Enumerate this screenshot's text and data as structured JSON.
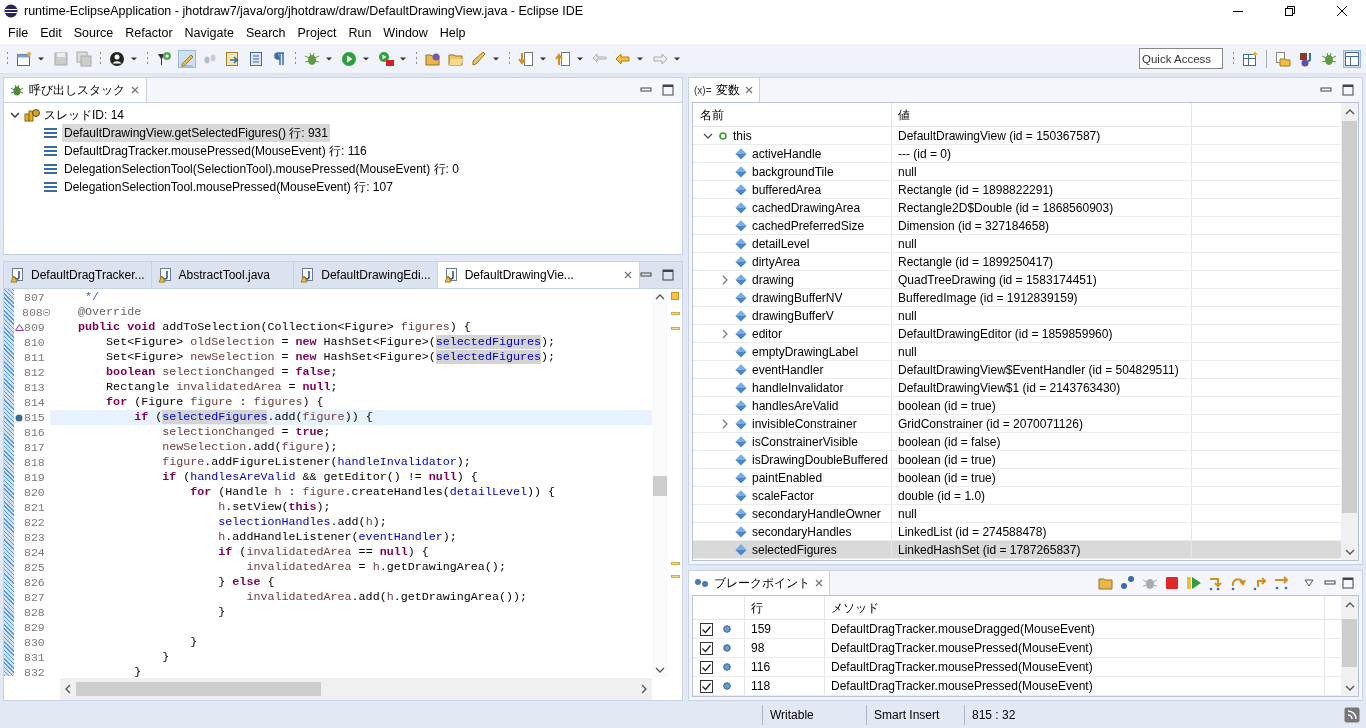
{
  "window": {
    "title": "runtime-EclipseApplication - jhotdraw7/java/org/jhotdraw/draw/DefaultDrawingView.java - Eclipse IDE"
  },
  "menu": [
    "File",
    "Edit",
    "Source",
    "Refactor",
    "Navigate",
    "Search",
    "Project",
    "Run",
    "Window",
    "Help"
  ],
  "quick_access": {
    "placeholder": "Quick Access"
  },
  "call_stack": {
    "title": "呼び出しスタック",
    "thread": {
      "label": "スレッドID: 14",
      "expanded": true
    },
    "frames": [
      {
        "label": "DefaultDrawingView.getSelectedFigures() 行: 931",
        "selected": true
      },
      {
        "label": "DefaultDragTracker.mousePressed(MouseEvent) 行: 116",
        "selected": false
      },
      {
        "label": "DelegationSelectionTool(SelectionTool).mousePressed(MouseEvent) 行: 0",
        "selected": false
      },
      {
        "label": "DelegationSelectionTool.mousePressed(MouseEvent) 行: 107",
        "selected": false
      }
    ]
  },
  "editor": {
    "tabs": [
      {
        "label": "DefaultDragTracker...",
        "selected": false
      },
      {
        "label": "AbstractTool.java",
        "selected": false
      },
      {
        "label": "DefaultDrawingEdi...",
        "selected": false
      },
      {
        "label": "DefaultDrawingVie...",
        "selected": true
      }
    ],
    "lines": [
      {
        "number": "807",
        "current": false,
        "breakpoint": false,
        "override": false,
        "fold_control": false,
        "tokens": [
          {
            "kind": "c",
            "text": "     */"
          }
        ]
      },
      {
        "number": "808",
        "current": false,
        "breakpoint": false,
        "override": false,
        "fold_control": true,
        "tokens": [
          {
            "kind": "a",
            "text": "    @Override"
          }
        ]
      },
      {
        "number": "809",
        "current": false,
        "breakpoint": false,
        "override": true,
        "fold_control": false,
        "tokens": [
          {
            "kind": "k",
            "text": "    public "
          },
          {
            "kind": "k",
            "text": "void"
          },
          {
            "kind": "t",
            "text": " addToSelection(Collection<Figure> "
          },
          {
            "kind": "v",
            "text": "figures"
          },
          {
            "kind": "t",
            "text": ") {"
          }
        ]
      },
      {
        "number": "810",
        "current": false,
        "breakpoint": false,
        "override": false,
        "fold_control": false,
        "tokens": [
          {
            "kind": "t",
            "text": "        Set<Figure> "
          },
          {
            "kind": "v",
            "text": "oldSelection"
          },
          {
            "kind": "t",
            "text": " = "
          },
          {
            "kind": "k",
            "text": "new"
          },
          {
            "kind": "t",
            "text": " HashSet<Figure>("
          },
          {
            "kind": "o",
            "text": "selectedFigures"
          },
          {
            "kind": "t",
            "text": ");"
          }
        ]
      },
      {
        "number": "811",
        "current": false,
        "breakpoint": false,
        "override": false,
        "fold_control": false,
        "tokens": [
          {
            "kind": "t",
            "text": "        Set<Figure> "
          },
          {
            "kind": "v",
            "text": "newSelection"
          },
          {
            "kind": "t",
            "text": " = "
          },
          {
            "kind": "k",
            "text": "new"
          },
          {
            "kind": "t",
            "text": " HashSet<Figure>("
          },
          {
            "kind": "o",
            "text": "selectedFigures"
          },
          {
            "kind": "t",
            "text": ");"
          }
        ]
      },
      {
        "number": "812",
        "current": false,
        "breakpoint": false,
        "override": false,
        "fold_control": false,
        "tokens": [
          {
            "kind": "k",
            "text": "        boolean"
          },
          {
            "kind": "v",
            "text": " selectionChanged"
          },
          {
            "kind": "t",
            "text": " = "
          },
          {
            "kind": "k",
            "text": "false"
          },
          {
            "kind": "t",
            "text": ";"
          }
        ]
      },
      {
        "number": "813",
        "current": false,
        "breakpoint": false,
        "override": false,
        "fold_control": false,
        "tokens": [
          {
            "kind": "t",
            "text": "        Rectangle "
          },
          {
            "kind": "v",
            "text": "invalidatedArea"
          },
          {
            "kind": "t",
            "text": " = "
          },
          {
            "kind": "k",
            "text": "null"
          },
          {
            "kind": "t",
            "text": ";"
          }
        ]
      },
      {
        "number": "814",
        "current": false,
        "breakpoint": false,
        "override": false,
        "fold_control": false,
        "tokens": [
          {
            "kind": "k",
            "text": "        for"
          },
          {
            "kind": "t",
            "text": " (Figure "
          },
          {
            "kind": "v",
            "text": "figure"
          },
          {
            "kind": "t",
            "text": " : "
          },
          {
            "kind": "v",
            "text": "figures"
          },
          {
            "kind": "t",
            "text": ") {"
          }
        ]
      },
      {
        "number": "815",
        "current": true,
        "breakpoint": true,
        "override": false,
        "fold_control": false,
        "tokens": [
          {
            "kind": "k",
            "text": "            if"
          },
          {
            "kind": "t",
            "text": " ("
          },
          {
            "kind": "o",
            "text": "selectedFigures"
          },
          {
            "kind": "t",
            "text": ".add("
          },
          {
            "kind": "v",
            "text": "figure"
          },
          {
            "kind": "t",
            "text": ")) {"
          }
        ]
      },
      {
        "number": "816",
        "current": false,
        "breakpoint": false,
        "override": false,
        "fold_control": false,
        "tokens": [
          {
            "kind": "v",
            "text": "                selectionChanged"
          },
          {
            "kind": "t",
            "text": " = "
          },
          {
            "kind": "k",
            "text": "true"
          },
          {
            "kind": "t",
            "text": ";"
          }
        ]
      },
      {
        "number": "817",
        "current": false,
        "breakpoint": false,
        "override": false,
        "fold_control": false,
        "tokens": [
          {
            "kind": "v",
            "text": "                newSelection"
          },
          {
            "kind": "t",
            "text": ".add("
          },
          {
            "kind": "v",
            "text": "figure"
          },
          {
            "kind": "t",
            "text": ");"
          }
        ]
      },
      {
        "number": "818",
        "current": false,
        "breakpoint": false,
        "override": false,
        "fold_control": false,
        "tokens": [
          {
            "kind": "v",
            "text": "                figure"
          },
          {
            "kind": "t",
            "text": ".addFigureListener("
          },
          {
            "kind": "f",
            "text": "handleInvalidator"
          },
          {
            "kind": "t",
            "text": ");"
          }
        ]
      },
      {
        "number": "819",
        "current": false,
        "breakpoint": false,
        "override": false,
        "fold_control": false,
        "tokens": [
          {
            "kind": "k",
            "text": "                if"
          },
          {
            "kind": "t",
            "text": " ("
          },
          {
            "kind": "f",
            "text": "handlesAreValid"
          },
          {
            "kind": "t",
            "text": " && getEditor() != "
          },
          {
            "kind": "k",
            "text": "null"
          },
          {
            "kind": "t",
            "text": ") {"
          }
        ]
      },
      {
        "number": "820",
        "current": false,
        "breakpoint": false,
        "override": false,
        "fold_control": false,
        "tokens": [
          {
            "kind": "k",
            "text": "                    for"
          },
          {
            "kind": "t",
            "text": " (Handle "
          },
          {
            "kind": "v",
            "text": "h"
          },
          {
            "kind": "t",
            "text": " : "
          },
          {
            "kind": "v",
            "text": "figure"
          },
          {
            "kind": "t",
            "text": ".createHandles("
          },
          {
            "kind": "f",
            "text": "detailLevel"
          },
          {
            "kind": "t",
            "text": ")) {"
          }
        ]
      },
      {
        "number": "821",
        "current": false,
        "breakpoint": false,
        "override": false,
        "fold_control": false,
        "tokens": [
          {
            "kind": "v",
            "text": "                        h"
          },
          {
            "kind": "t",
            "text": ".setView("
          },
          {
            "kind": "k",
            "text": "this"
          },
          {
            "kind": "t",
            "text": ");"
          }
        ]
      },
      {
        "number": "822",
        "current": false,
        "breakpoint": false,
        "override": false,
        "fold_control": false,
        "tokens": [
          {
            "kind": "f",
            "text": "                        selectionHandles"
          },
          {
            "kind": "t",
            "text": ".add("
          },
          {
            "kind": "v",
            "text": "h"
          },
          {
            "kind": "t",
            "text": ");"
          }
        ]
      },
      {
        "number": "823",
        "current": false,
        "breakpoint": false,
        "override": false,
        "fold_control": false,
        "tokens": [
          {
            "kind": "v",
            "text": "                        h"
          },
          {
            "kind": "t",
            "text": ".addHandleListener("
          },
          {
            "kind": "f",
            "text": "eventHandler"
          },
          {
            "kind": "t",
            "text": ");"
          }
        ]
      },
      {
        "number": "824",
        "current": false,
        "breakpoint": false,
        "override": false,
        "fold_control": false,
        "tokens": [
          {
            "kind": "k",
            "text": "                        if"
          },
          {
            "kind": "t",
            "text": " ("
          },
          {
            "kind": "v",
            "text": "invalidatedArea"
          },
          {
            "kind": "t",
            "text": " == "
          },
          {
            "kind": "k",
            "text": "null"
          },
          {
            "kind": "t",
            "text": ") {"
          }
        ]
      },
      {
        "number": "825",
        "current": false,
        "breakpoint": false,
        "override": false,
        "fold_control": false,
        "tokens": [
          {
            "kind": "v",
            "text": "                            invalidatedArea"
          },
          {
            "kind": "t",
            "text": " = "
          },
          {
            "kind": "v",
            "text": "h"
          },
          {
            "kind": "t",
            "text": ".getDrawingArea();"
          }
        ]
      },
      {
        "number": "826",
        "current": false,
        "breakpoint": false,
        "override": false,
        "fold_control": false,
        "tokens": [
          {
            "kind": "t",
            "text": "                        } "
          },
          {
            "kind": "k",
            "text": "else"
          },
          {
            "kind": "t",
            "text": " {"
          }
        ]
      },
      {
        "number": "827",
        "current": false,
        "breakpoint": false,
        "override": false,
        "fold_control": false,
        "tokens": [
          {
            "kind": "v",
            "text": "                            invalidatedArea"
          },
          {
            "kind": "t",
            "text": ".add("
          },
          {
            "kind": "v",
            "text": "h"
          },
          {
            "kind": "t",
            "text": ".getDrawingArea());"
          }
        ]
      },
      {
        "number": "828",
        "current": false,
        "breakpoint": false,
        "override": false,
        "fold_control": false,
        "tokens": [
          {
            "kind": "t",
            "text": "                        }"
          }
        ]
      },
      {
        "number": "829",
        "current": false,
        "breakpoint": false,
        "override": false,
        "fold_control": false
      },
      {
        "number": "830",
        "current": false,
        "breakpoint": false,
        "override": false,
        "fold_control": false,
        "tokens": [
          {
            "kind": "t",
            "text": "                    }"
          }
        ]
      },
      {
        "number": "831",
        "current": false,
        "breakpoint": false,
        "override": false,
        "fold_control": false,
        "tokens": [
          {
            "kind": "t",
            "text": "                }"
          }
        ]
      },
      {
        "number": "832",
        "current": false,
        "breakpoint": false,
        "override": false,
        "fold_control": false,
        "tokens": [
          {
            "kind": "t",
            "text": "            }"
          }
        ]
      }
    ]
  },
  "variables": {
    "title": "変数",
    "title_prefix": "(x)=",
    "columns": [
      "名前",
      "値"
    ],
    "rows": [
      {
        "name": "this",
        "value": "DefaultDrawingView (id = 150367587)",
        "expanded": true,
        "selected": false,
        "children": [
          {
            "name": "activeHandle",
            "value": "--- (id = 0)",
            "expandable": false,
            "selected": false
          },
          {
            "name": "backgroundTile",
            "value": "null",
            "expandable": false,
            "selected": false
          },
          {
            "name": "bufferedArea",
            "value": "Rectangle (id = 1898822291)",
            "expandable": false,
            "selected": false
          },
          {
            "name": "cachedDrawingArea",
            "value": "Rectangle2D$Double (id = 1868560903)",
            "expandable": false,
            "selected": false
          },
          {
            "name": "cachedPreferredSize",
            "value": "Dimension (id = 327184658)",
            "expandable": false,
            "selected": false
          },
          {
            "name": "detailLevel",
            "value": "null",
            "expandable": false,
            "selected": false
          },
          {
            "name": "dirtyArea",
            "value": "Rectangle (id = 1899250417)",
            "expandable": false,
            "selected": false
          },
          {
            "name": "drawing",
            "value": "QuadTreeDrawing (id = 1583174451)",
            "expandable": true,
            "selected": false
          },
          {
            "name": "drawingBufferNV",
            "value": "BufferedImage (id = 1912839159)",
            "expandable": false,
            "selected": false
          },
          {
            "name": "drawingBufferV",
            "value": "null",
            "expandable": false,
            "selected": false
          },
          {
            "name": "editor",
            "value": "DefaultDrawingEditor (id = 1859859960)",
            "expandable": true,
            "selected": false
          },
          {
            "name": "emptyDrawingLabel",
            "value": "null",
            "expandable": false,
            "selected": false
          },
          {
            "name": "eventHandler",
            "value": "DefaultDrawingView$EventHandler (id = 504829511)",
            "expandable": false,
            "selected": false
          },
          {
            "name": "handleInvalidator",
            "value": "DefaultDrawingView$1 (id = 2143763430)",
            "expandable": false,
            "selected": false
          },
          {
            "name": "handlesAreValid",
            "value": "boolean (id = true)",
            "expandable": false,
            "selected": false
          },
          {
            "name": "invisibleConstrainer",
            "value": "GridConstrainer (id = 2070071126)",
            "expandable": true,
            "selected": false
          },
          {
            "name": "isConstrainerVisible",
            "value": "boolean (id = false)",
            "expandable": false,
            "selected": false
          },
          {
            "name": "isDrawingDoubleBuffered",
            "value": "boolean (id = true)",
            "expandable": false,
            "selected": false
          },
          {
            "name": "paintEnabled",
            "value": "boolean (id = true)",
            "expandable": false,
            "selected": false
          },
          {
            "name": "scaleFactor",
            "value": "double (id = 1.0)",
            "expandable": false,
            "selected": false
          },
          {
            "name": "secondaryHandleOwner",
            "value": "null",
            "expandable": false,
            "selected": false
          },
          {
            "name": "secondaryHandles",
            "value": "LinkedList (id = 274588478)",
            "expandable": false,
            "selected": false
          },
          {
            "name": "selectedFigures",
            "value": "LinkedHashSet (id = 1787265837)",
            "expandable": false,
            "selected": true
          }
        ]
      }
    ]
  },
  "breakpoints": {
    "title": "ブレークポイント",
    "columns": [
      "行",
      "メソッド"
    ],
    "rows": [
      {
        "checked": true,
        "line": "159",
        "method": "DefaultDragTracker.mouseDragged(MouseEvent)"
      },
      {
        "checked": true,
        "line": "98",
        "method": "DefaultDragTracker.mousePressed(MouseEvent)"
      },
      {
        "checked": true,
        "line": "116",
        "method": "DefaultDragTracker.mousePressed(MouseEvent)"
      },
      {
        "checked": true,
        "line": "118",
        "method": "DefaultDragTracker.mousePressed(MouseEvent)"
      }
    ]
  },
  "status_bar": [
    "Writable",
    "Smart Insert",
    "815 : 32"
  ]
}
